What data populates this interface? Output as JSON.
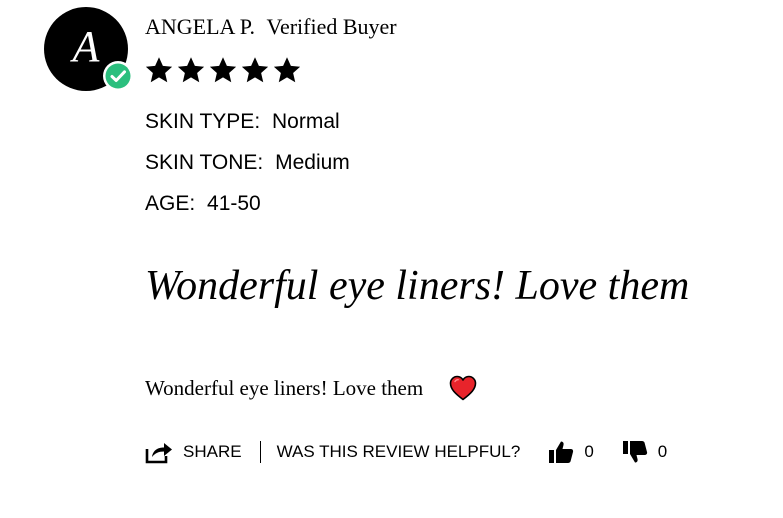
{
  "review": {
    "author_initial": "A",
    "author_name": "ANGELA P.",
    "verified_label": "Verified Buyer",
    "rating": 5,
    "rating_max": 5,
    "attributes": [
      {
        "label": "SKIN TYPE:",
        "value": "Normal"
      },
      {
        "label": "SKIN TONE:",
        "value": "Medium"
      },
      {
        "label": "AGE:",
        "value": "41-50"
      }
    ],
    "headline": "Wonderful eye liners! Love them",
    "body": "Wonderful eye liners! Love them"
  },
  "footer": {
    "share_label": "SHARE",
    "helpful_label": "WAS THIS REVIEW HELPFUL?",
    "helpful_yes_count": "0",
    "helpful_no_count": "0"
  },
  "icons": {
    "verified": "check-circle-icon",
    "star": "star-icon",
    "heart": "heart-emoji-icon",
    "share": "share-icon",
    "thumbs_up": "thumbs-up-icon",
    "thumbs_down": "thumbs-down-icon"
  },
  "colors": {
    "verified_badge": "#2bbf7e",
    "heart": "#e8242b",
    "text": "#000000"
  }
}
